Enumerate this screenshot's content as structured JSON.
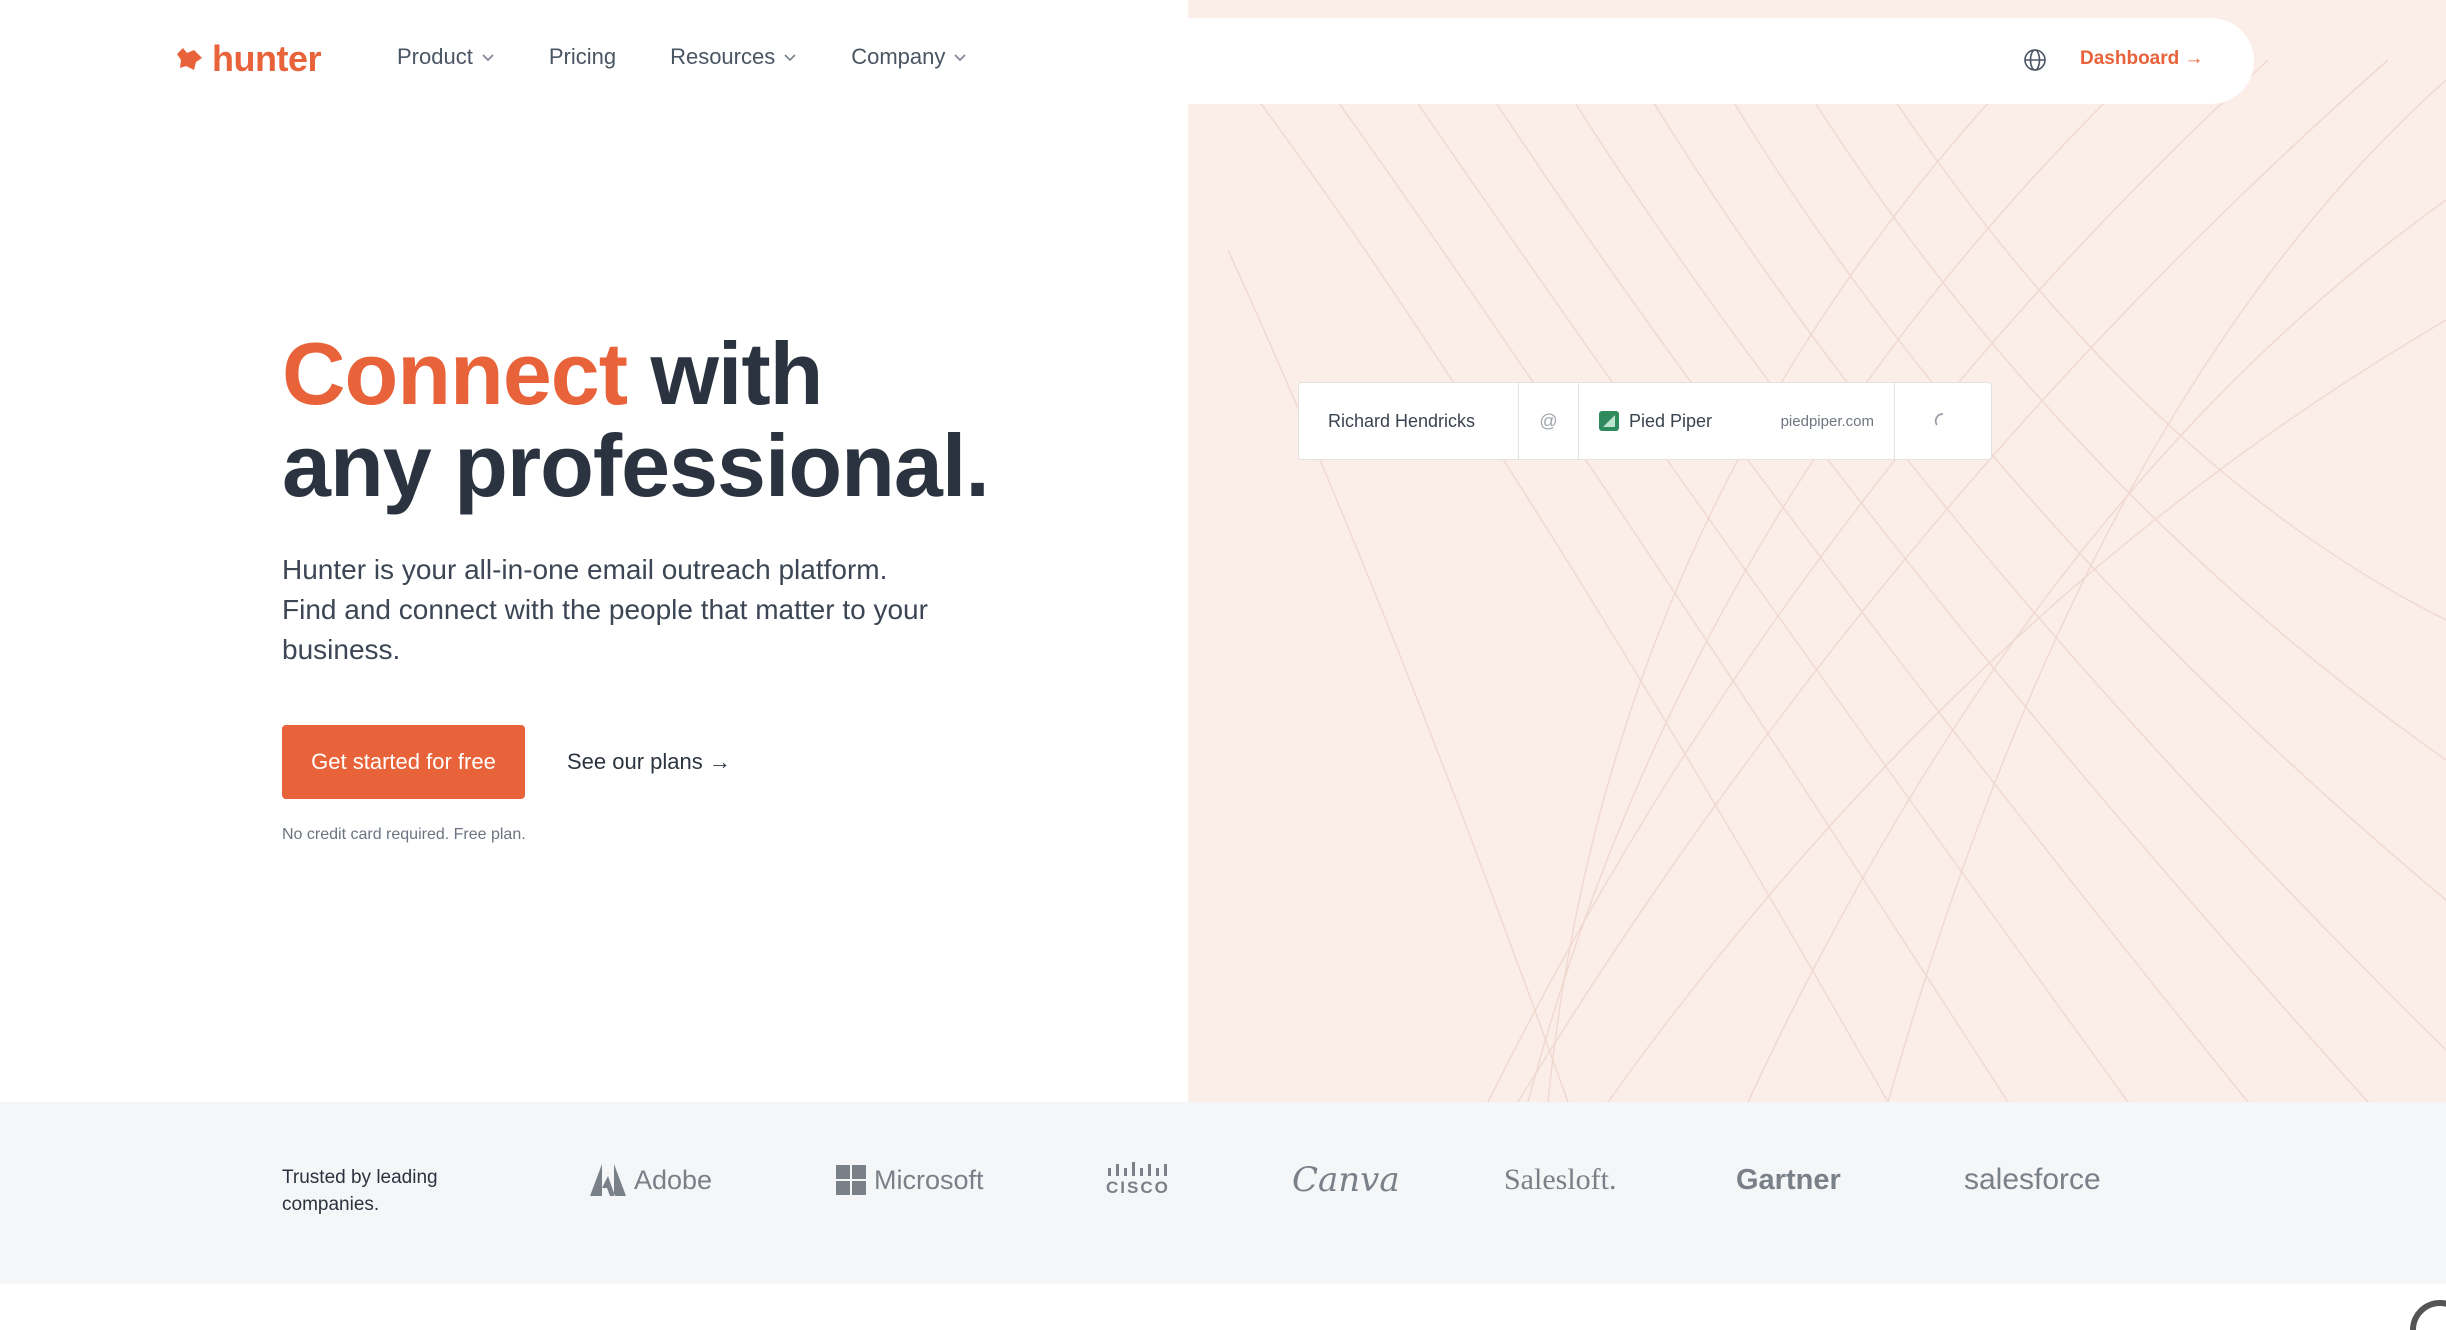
{
  "brand": {
    "name": "hunter",
    "accent": "#e8623a"
  },
  "nav": {
    "items": [
      {
        "label": "Product",
        "dropdown": true
      },
      {
        "label": "Pricing",
        "dropdown": false
      },
      {
        "label": "Resources",
        "dropdown": true
      },
      {
        "label": "Company",
        "dropdown": true
      }
    ],
    "dashboard": "Dashboard →"
  },
  "hero": {
    "headline_accent": "Connect",
    "headline_rest_1": " with",
    "headline_rest_2": "any professional.",
    "subtext": "Hunter is your all-in-one email outreach platform. Find and connect with the people that matter to your business.",
    "cta": "Get started for free",
    "plans": "See our plans →",
    "fineprint": "No credit card required. Free plan."
  },
  "search": {
    "name": "Richard Hendricks",
    "at": "@",
    "company": "Pied Piper",
    "domain": "piedpiper.com"
  },
  "trusted": {
    "label": "Trusted by leading companies.",
    "logos": [
      "Adobe",
      "Microsoft",
      "CISCO",
      "Canva",
      "Salesloft.",
      "Gartner",
      "salesforce"
    ]
  }
}
